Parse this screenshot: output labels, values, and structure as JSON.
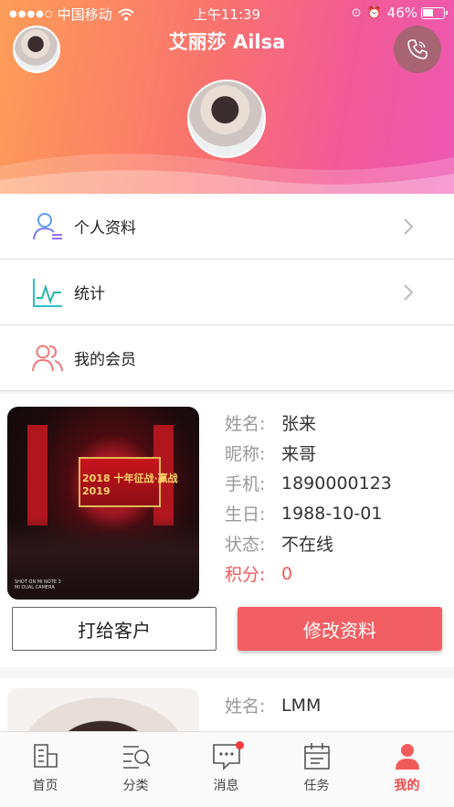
{
  "status_bar": {
    "carrier": "中国移动",
    "time": "上午11:39",
    "battery": "46%"
  },
  "header": {
    "title": "艾丽莎 Ailsa"
  },
  "menu": [
    {
      "label": "个人资料"
    },
    {
      "label": "统计"
    },
    {
      "label": "我的会员"
    }
  ],
  "members": [
    {
      "fields": [
        {
          "key": "姓名:",
          "value": "张来"
        },
        {
          "key": "昵称:",
          "value": "来哥"
        },
        {
          "key": "手机:",
          "value": "1890000123"
        },
        {
          "key": "生日:",
          "value": "1988-10-01"
        },
        {
          "key": "状态:",
          "value": "不在线"
        },
        {
          "key": "积分:",
          "value": "0"
        }
      ],
      "photo_text": "2018 十年征战·赢战2019",
      "camera_tag": "SHOT ON MI NOTE 3\nMI DUAL CAMERA",
      "call_label": "打给客户",
      "edit_label": "修改资料"
    },
    {
      "fields": [
        {
          "key": "姓名:",
          "value": "LMM"
        }
      ]
    }
  ],
  "tabs": [
    {
      "label": "首页",
      "icon": "home-icon"
    },
    {
      "label": "分类",
      "icon": "category-icon"
    },
    {
      "label": "消息",
      "icon": "message-icon"
    },
    {
      "label": "任务",
      "icon": "task-icon"
    },
    {
      "label": "我的",
      "icon": "profile-icon",
      "active": true
    }
  ],
  "colors": {
    "accent": "#f25f63",
    "active_tab": "#f24a4a"
  }
}
